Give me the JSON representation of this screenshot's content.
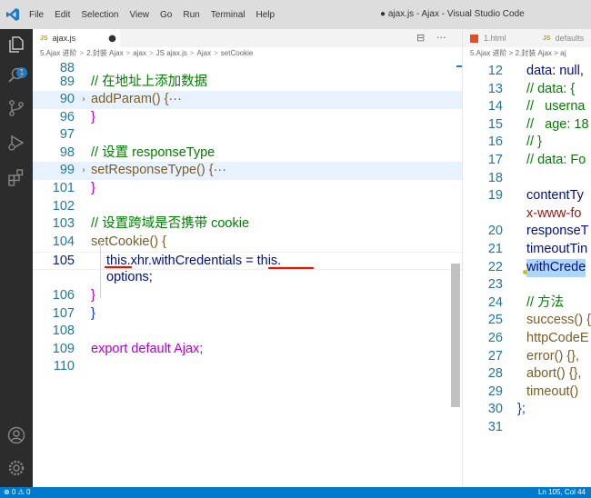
{
  "titlebar": {
    "menu": [
      "File",
      "Edit",
      "Selection",
      "View",
      "Go",
      "Run",
      "Terminal",
      "Help"
    ],
    "window_title": "● ajax.js - Ajax - Visual Studio Code"
  },
  "activity_bar": {
    "badge": "1",
    "icons": [
      "explorer-icon",
      "search-icon",
      "source-control-icon",
      "run-debug-icon",
      "extensions-icon",
      "account-icon",
      "settings-gear-icon"
    ]
  },
  "left_editor": {
    "tab": {
      "badge": "JS",
      "label": "ajax.js",
      "dirty": "●"
    },
    "tab_actions": [
      "⊟",
      "···"
    ],
    "breadcrumb": [
      "5.Ajax 进阶",
      "2.封装 Ajax",
      "ajax",
      "JS ajax.js",
      "Ajax",
      "setCookie"
    ],
    "lines": [
      {
        "n": "88",
        "text": ""
      },
      {
        "n": "89",
        "text": "// 在地址上添加数据"
      },
      {
        "n": "90",
        "text": "addParam() {···"
      },
      {
        "n": "96",
        "text": "}"
      },
      {
        "n": "97",
        "text": ""
      },
      {
        "n": "98",
        "text": "// 设置 responseType"
      },
      {
        "n": "99",
        "text": "setResponseType() {···"
      },
      {
        "n": "101",
        "text": "}"
      },
      {
        "n": "102",
        "text": ""
      },
      {
        "n": "103",
        "text": "// 设置跨域是否携带 cookie"
      },
      {
        "n": "104",
        "text": "setCookie() {"
      },
      {
        "n": "105",
        "text": "this.xhr.withCredentials = this."
      },
      {
        "n": "",
        "text": "options;"
      },
      {
        "n": "106",
        "text": "}"
      },
      {
        "n": "107",
        "text": "}"
      },
      {
        "n": "108",
        "text": ""
      },
      {
        "n": "109",
        "text": "export default Ajax;"
      },
      {
        "n": "110",
        "text": ""
      }
    ]
  },
  "right_editor": {
    "tabs": [
      {
        "badge": "",
        "label": "1.html"
      },
      {
        "badge": "JS",
        "label": "defaults"
      }
    ],
    "breadcrumb": "5.Ajax 进阶 > 2.封装 Ajax > aj",
    "lines": [
      {
        "n": "12",
        "text": "data: null,"
      },
      {
        "n": "13",
        "text": "// data: {"
      },
      {
        "n": "14",
        "text": "//   userna"
      },
      {
        "n": "15",
        "text": "//   age: 18"
      },
      {
        "n": "16",
        "text": "// }"
      },
      {
        "n": "17",
        "text": "// data: Fo"
      },
      {
        "n": "18",
        "text": ""
      },
      {
        "n": "19",
        "text": "contentTy"
      },
      {
        "n": "",
        "text": "x-www-fo"
      },
      {
        "n": "20",
        "text": "responseT"
      },
      {
        "n": "21",
        "text": "timeoutTin"
      },
      {
        "n": "22",
        "text": "withCrede"
      },
      {
        "n": "23",
        "text": ""
      },
      {
        "n": "24",
        "text": "// 方法"
      },
      {
        "n": "25",
        "text": "success() {"
      },
      {
        "n": "26",
        "text": "httpCodeE"
      },
      {
        "n": "27",
        "text": "error() {},"
      },
      {
        "n": "28",
        "text": "abort() {},"
      },
      {
        "n": "29",
        "text": "timeout()"
      },
      {
        "n": "30",
        "text": "};"
      },
      {
        "n": "31",
        "text": ""
      }
    ]
  },
  "statusbar": {
    "left": "⊗ 0 ⚠ 0",
    "right": "Ln 105, Col 44"
  },
  "colors": {
    "activity_bg": "#2c2c2c",
    "status_bg": "#007acc",
    "annotation_underline": "#e51400"
  }
}
